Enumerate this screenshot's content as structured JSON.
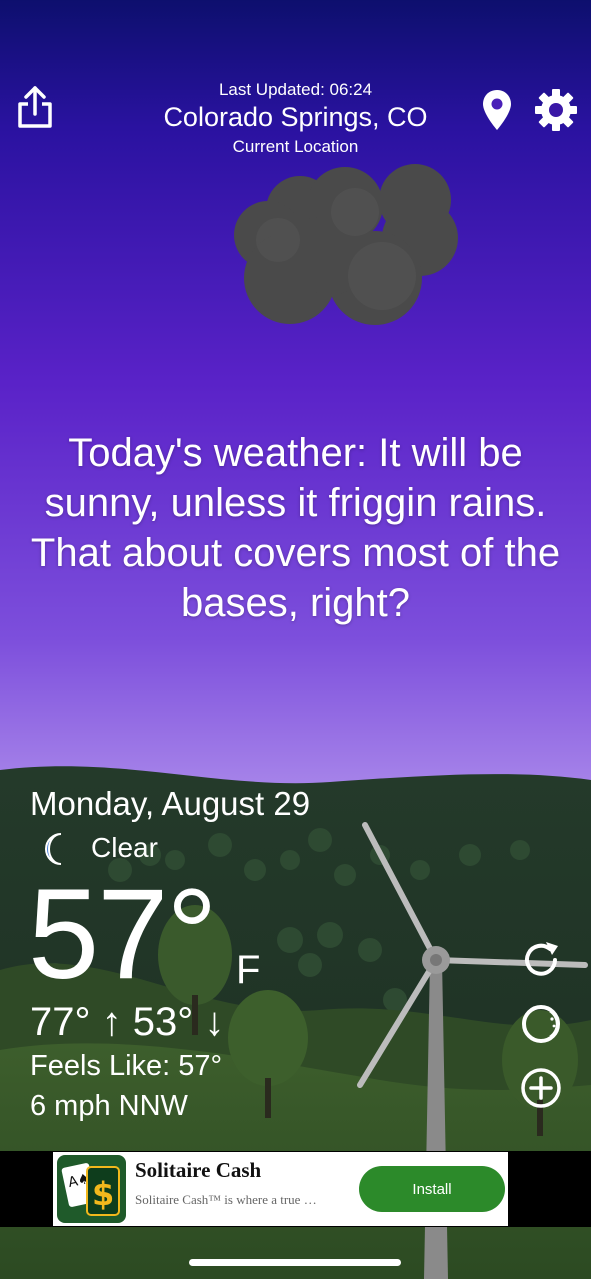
{
  "header": {
    "last_updated": "Last Updated: 06:24",
    "city": "Colorado Springs, CO",
    "location_label": "Current Location",
    "icons": [
      "share-icon",
      "location-pin-icon",
      "gear-icon"
    ]
  },
  "condition_graphic": "dark-cloud",
  "quote": "Today's weather: It will be sunny, unless it friggin rains. That about covers most of the bases, right?",
  "weather": {
    "date": "Monday, August 29",
    "condition_icon": "moon-icon",
    "condition": "Clear",
    "temperature": "57°",
    "unit": "F",
    "high_low": "77° ↑  53° ↓",
    "feels_like": "Feels Like: 57°",
    "wind": "6 mph NNW"
  },
  "controls": [
    "refresh-icon",
    "theme-icon",
    "add-icon"
  ],
  "ad": {
    "title": "Solitaire Cash",
    "description": "Solitaire Cash™ is where a true …",
    "install_label": "Install"
  },
  "colors": {
    "sky_top": "#0d0f6e",
    "sky_mid": "#5a22c8",
    "sky_bottom": "#c0a8f2",
    "hill_dark": "#1f3526",
    "hill_green": "#3a5a2a",
    "install_green": "#2c8a2a"
  }
}
